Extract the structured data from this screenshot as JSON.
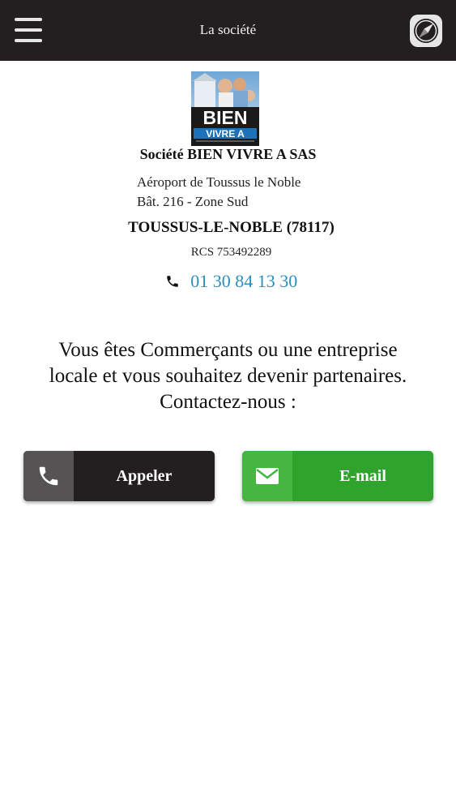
{
  "header": {
    "title": "La société",
    "menu_icon": "hamburger-menu-icon",
    "nav_icon": "compass-icon",
    "bg_color": "#231f20"
  },
  "logo": {
    "line1": "BIEN",
    "line2": "VIVRE A"
  },
  "company": {
    "name": "Société BIEN VIVRE A SAS",
    "address_line1": "Aéroport de Toussus le Noble",
    "address_line2": "Bât. 216 - Zone Sud",
    "city": "TOUSSUS-LE-NOBLE (78117)",
    "rcs": "RCS 753492289",
    "phone": "01 30 84 13 30",
    "phone_color": "#2a8fbf"
  },
  "partner": {
    "line1": "Vous êtes Commerçants ou une entreprise",
    "line2": "locale et vous souhaitez devenir partenaires.",
    "line3": "Contactez-nous :"
  },
  "actions": {
    "call_label": "Appeler",
    "call_icon": "phone-icon",
    "call_color": "#231f20",
    "email_label": "E-mail",
    "email_icon": "envelope-icon",
    "email_color": "#2fa32c"
  }
}
